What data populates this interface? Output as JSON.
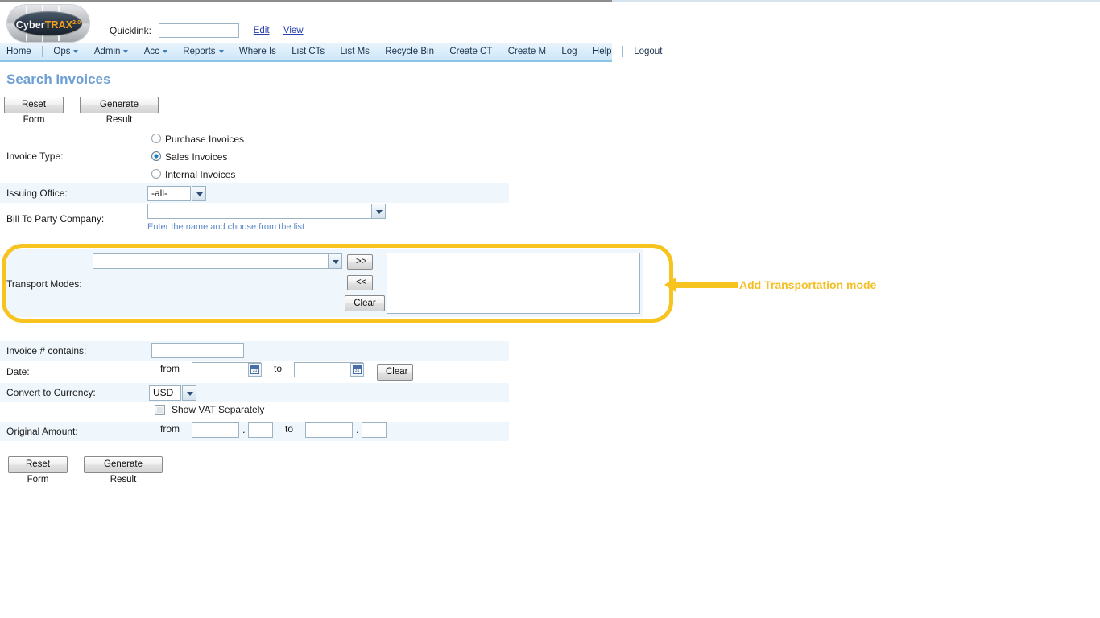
{
  "app": {
    "logo": {
      "part1": "Cyber",
      "part2": "TRAX",
      "version": "2.0"
    },
    "quicklink": {
      "label": "Quicklink:",
      "value": "",
      "placeholder": "",
      "edit_link": "Edit",
      "view_link": "View"
    },
    "nav": [
      {
        "label": "Home",
        "has_caret": false
      },
      {
        "label": "Ops",
        "has_caret": true
      },
      {
        "label": "Admin",
        "has_caret": true
      },
      {
        "label": "Acc",
        "has_caret": true
      },
      {
        "label": "Reports",
        "has_caret": true
      },
      {
        "label": "Where Is",
        "has_caret": false
      },
      {
        "label": "List CTs",
        "has_caret": false
      },
      {
        "label": "List Ms",
        "has_caret": false
      },
      {
        "label": "Recycle Bin",
        "has_caret": false
      },
      {
        "label": "Create CT",
        "has_caret": false
      },
      {
        "label": "Create M",
        "has_caret": false
      },
      {
        "label": "Log",
        "has_caret": false
      },
      {
        "label": "Help",
        "has_caret": false
      },
      {
        "label": "Logout",
        "has_caret": false
      }
    ]
  },
  "page": {
    "title": "Search Invoices",
    "title_color": "#6e9fd4"
  },
  "actions": {
    "reset_label": "Reset Form",
    "generate_label": "Generate Result"
  },
  "form": {
    "invoice_type": {
      "label": "Invoice Type:",
      "options": [
        {
          "label": "Purchase Invoices",
          "selected": false
        },
        {
          "label": "Sales Invoices",
          "selected": true
        },
        {
          "label": "Internal Invoices",
          "selected": false
        }
      ]
    },
    "issuing_office": {
      "label": "Issuing Office:",
      "value": "-all-"
    },
    "bill_to_party": {
      "label": "Bill To Party Company:",
      "value": "",
      "helper": "Enter the name and choose from the list"
    },
    "transport_modes": {
      "label": "Transport Modes:",
      "value": "",
      "add_label": ">>",
      "remove_label": "<<",
      "clear_label": "Clear",
      "selected_items": []
    },
    "invoice_contains": {
      "label": "Invoice # contains:",
      "value": ""
    },
    "date": {
      "label": "Date:",
      "from_word": "from",
      "to_word": "to",
      "from_value": "",
      "to_value": "",
      "clear_label": "Clear",
      "calendar_icon_text": "31"
    },
    "convert_currency": {
      "label": "Convert to Currency:",
      "value": "USD"
    },
    "show_vat": {
      "label": "Show VAT Separately",
      "checked": false
    },
    "original_amount": {
      "label": "Original Amount:",
      "from_word": "from",
      "to_word": "to",
      "from_whole": "",
      "from_decimal": "",
      "to_whole": "",
      "to_decimal": "",
      "separator": "."
    }
  },
  "annotation": {
    "text": "Add Transportation mode",
    "color": "#f3bf26"
  }
}
